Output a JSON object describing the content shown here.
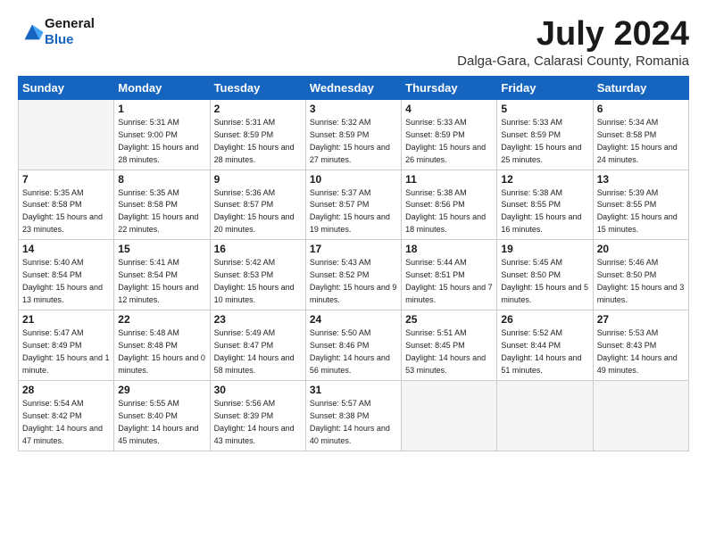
{
  "logo": {
    "general": "General",
    "blue": "Blue"
  },
  "title": "July 2024",
  "location": "Dalga-Gara, Calarasi County, Romania",
  "weekdays": [
    "Sunday",
    "Monday",
    "Tuesday",
    "Wednesday",
    "Thursday",
    "Friday",
    "Saturday"
  ],
  "weeks": [
    [
      {
        "day": "",
        "empty": true
      },
      {
        "day": "1",
        "rise": "5:31 AM",
        "set": "9:00 PM",
        "daylight": "15 hours and 28 minutes."
      },
      {
        "day": "2",
        "rise": "5:31 AM",
        "set": "8:59 PM",
        "daylight": "15 hours and 28 minutes."
      },
      {
        "day": "3",
        "rise": "5:32 AM",
        "set": "8:59 PM",
        "daylight": "15 hours and 27 minutes."
      },
      {
        "day": "4",
        "rise": "5:33 AM",
        "set": "8:59 PM",
        "daylight": "15 hours and 26 minutes."
      },
      {
        "day": "5",
        "rise": "5:33 AM",
        "set": "8:59 PM",
        "daylight": "15 hours and 25 minutes."
      },
      {
        "day": "6",
        "rise": "5:34 AM",
        "set": "8:58 PM",
        "daylight": "15 hours and 24 minutes."
      }
    ],
    [
      {
        "day": "7",
        "rise": "5:35 AM",
        "set": "8:58 PM",
        "daylight": "15 hours and 23 minutes."
      },
      {
        "day": "8",
        "rise": "5:35 AM",
        "set": "8:58 PM",
        "daylight": "15 hours and 22 minutes."
      },
      {
        "day": "9",
        "rise": "5:36 AM",
        "set": "8:57 PM",
        "daylight": "15 hours and 20 minutes."
      },
      {
        "day": "10",
        "rise": "5:37 AM",
        "set": "8:57 PM",
        "daylight": "15 hours and 19 minutes."
      },
      {
        "day": "11",
        "rise": "5:38 AM",
        "set": "8:56 PM",
        "daylight": "15 hours and 18 minutes."
      },
      {
        "day": "12",
        "rise": "5:38 AM",
        "set": "8:55 PM",
        "daylight": "15 hours and 16 minutes."
      },
      {
        "day": "13",
        "rise": "5:39 AM",
        "set": "8:55 PM",
        "daylight": "15 hours and 15 minutes."
      }
    ],
    [
      {
        "day": "14",
        "rise": "5:40 AM",
        "set": "8:54 PM",
        "daylight": "15 hours and 13 minutes."
      },
      {
        "day": "15",
        "rise": "5:41 AM",
        "set": "8:54 PM",
        "daylight": "15 hours and 12 minutes."
      },
      {
        "day": "16",
        "rise": "5:42 AM",
        "set": "8:53 PM",
        "daylight": "15 hours and 10 minutes."
      },
      {
        "day": "17",
        "rise": "5:43 AM",
        "set": "8:52 PM",
        "daylight": "15 hours and 9 minutes."
      },
      {
        "day": "18",
        "rise": "5:44 AM",
        "set": "8:51 PM",
        "daylight": "15 hours and 7 minutes."
      },
      {
        "day": "19",
        "rise": "5:45 AM",
        "set": "8:50 PM",
        "daylight": "15 hours and 5 minutes."
      },
      {
        "day": "20",
        "rise": "5:46 AM",
        "set": "8:50 PM",
        "daylight": "15 hours and 3 minutes."
      }
    ],
    [
      {
        "day": "21",
        "rise": "5:47 AM",
        "set": "8:49 PM",
        "daylight": "15 hours and 1 minute."
      },
      {
        "day": "22",
        "rise": "5:48 AM",
        "set": "8:48 PM",
        "daylight": "15 hours and 0 minutes."
      },
      {
        "day": "23",
        "rise": "5:49 AM",
        "set": "8:47 PM",
        "daylight": "14 hours and 58 minutes."
      },
      {
        "day": "24",
        "rise": "5:50 AM",
        "set": "8:46 PM",
        "daylight": "14 hours and 56 minutes."
      },
      {
        "day": "25",
        "rise": "5:51 AM",
        "set": "8:45 PM",
        "daylight": "14 hours and 53 minutes."
      },
      {
        "day": "26",
        "rise": "5:52 AM",
        "set": "8:44 PM",
        "daylight": "14 hours and 51 minutes."
      },
      {
        "day": "27",
        "rise": "5:53 AM",
        "set": "8:43 PM",
        "daylight": "14 hours and 49 minutes."
      }
    ],
    [
      {
        "day": "28",
        "rise": "5:54 AM",
        "set": "8:42 PM",
        "daylight": "14 hours and 47 minutes."
      },
      {
        "day": "29",
        "rise": "5:55 AM",
        "set": "8:40 PM",
        "daylight": "14 hours and 45 minutes."
      },
      {
        "day": "30",
        "rise": "5:56 AM",
        "set": "8:39 PM",
        "daylight": "14 hours and 43 minutes."
      },
      {
        "day": "31",
        "rise": "5:57 AM",
        "set": "8:38 PM",
        "daylight": "14 hours and 40 minutes."
      },
      {
        "day": "",
        "empty": true
      },
      {
        "day": "",
        "empty": true
      },
      {
        "day": "",
        "empty": true
      }
    ]
  ]
}
